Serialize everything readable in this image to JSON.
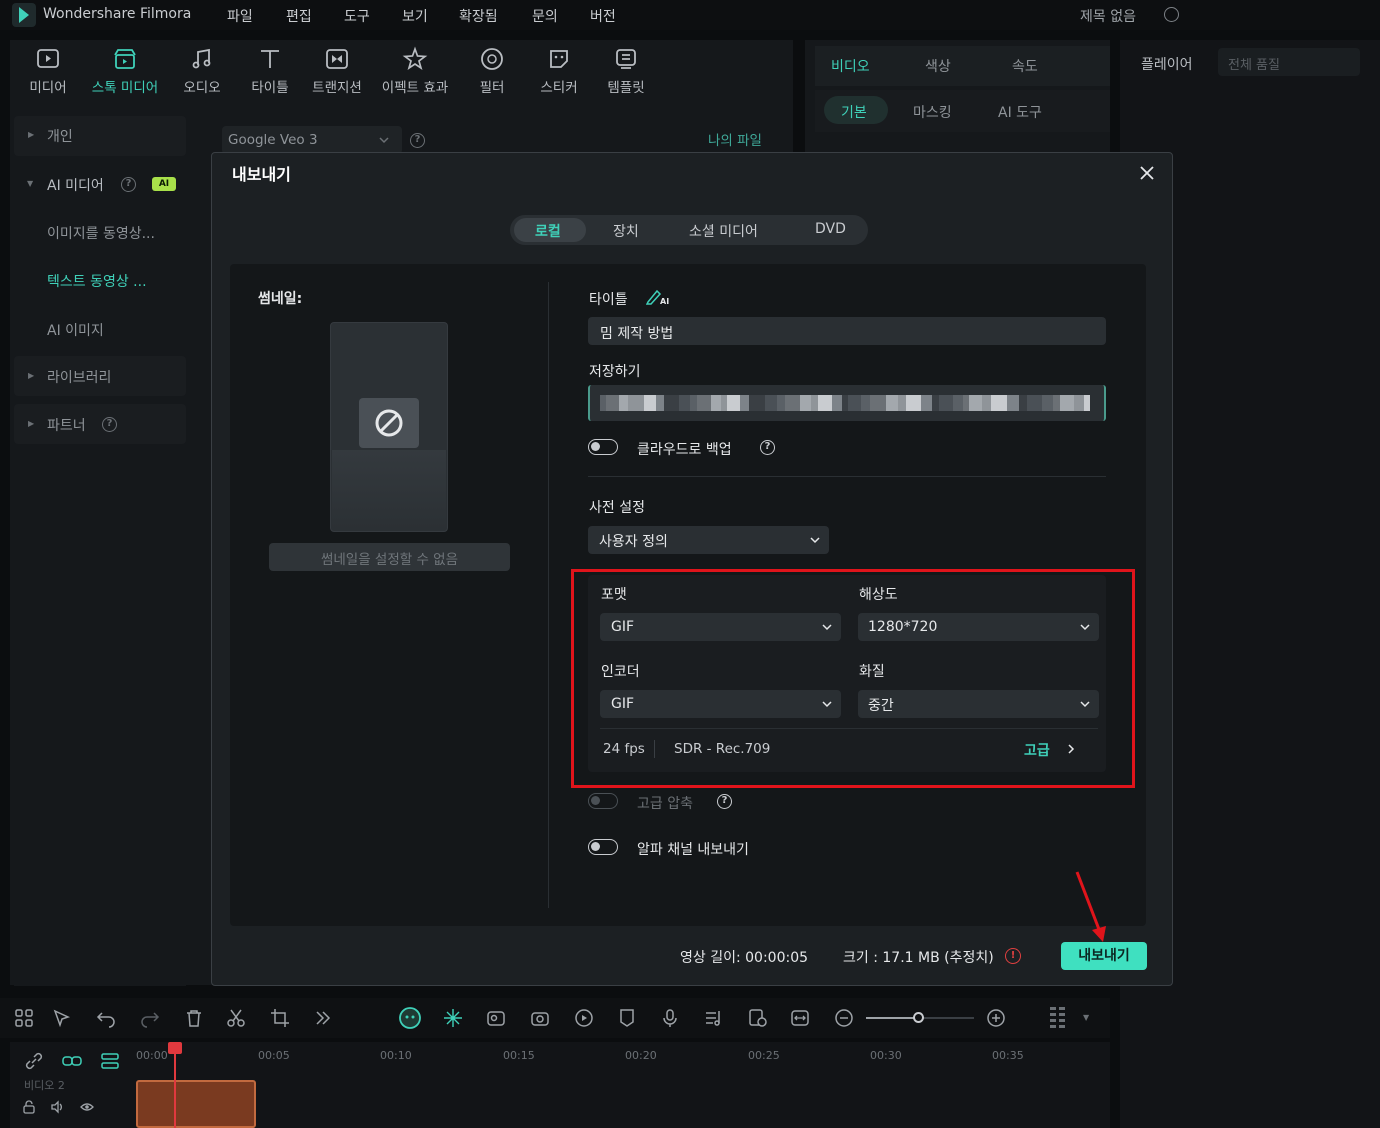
{
  "app": {
    "name": "Wondershare Filmora",
    "menu": [
      "파일",
      "편집",
      "도구",
      "보기",
      "확장됨",
      "문의",
      "버전"
    ],
    "doc_title": "제목 없음"
  },
  "toolbar": {
    "items": [
      {
        "label": "미디어",
        "icon": "media-icon"
      },
      {
        "label": "스톡 미디어",
        "icon": "stock-media-icon",
        "active": true
      },
      {
        "label": "오디오",
        "icon": "audio-icon"
      },
      {
        "label": "타이틀",
        "icon": "title-icon"
      },
      {
        "label": "트랜지션",
        "icon": "transition-icon"
      },
      {
        "label": "이펙트 효과",
        "icon": "effects-icon"
      },
      {
        "label": "필터",
        "icon": "filter-icon"
      },
      {
        "label": "스티커",
        "icon": "sticker-icon"
      },
      {
        "label": "템플릿",
        "icon": "template-icon"
      }
    ]
  },
  "library": {
    "items": [
      {
        "label": "개인"
      },
      {
        "label": "AI 미디어",
        "badge": "AI"
      },
      {
        "label": "이미지를 동영상..."
      },
      {
        "label": "텍스트 동영상 ..."
      },
      {
        "label": "AI 이미지"
      },
      {
        "label": "라이브러리"
      },
      {
        "label": "파트너"
      }
    ],
    "model_select": "Google Veo 3",
    "my_files": "나의 파일"
  },
  "right_panel": {
    "tabs": [
      "비디오",
      "색상",
      "속도"
    ],
    "sub_tabs": [
      "기본",
      "마스킹",
      "AI 도구"
    ]
  },
  "player": {
    "label": "플레이어",
    "quality": "전체 품질"
  },
  "timeline": {
    "timecodes": [
      "00:00",
      "00:05",
      "00:10",
      "00:15",
      "00:20",
      "00:25",
      "00:30",
      "00:35"
    ],
    "track": "비디오 2"
  },
  "dialog": {
    "title": "내보내기",
    "tabs": [
      "로컬",
      "장치",
      "소셜 미디어",
      "DVD"
    ],
    "thumbnail_label": "썸네일:",
    "thumbnail_button": "썸네일을 설정할 수 없음",
    "title_label": "타이틀",
    "title_value": "밈 제작 방법",
    "save_label": "저장하기",
    "cloud_backup": "클라우드로 백업",
    "preset_label": "사전 설정",
    "preset_value": "사용자 정의",
    "format_label": "포맷",
    "format_value": "GIF",
    "resolution_label": "해상도",
    "resolution_value": "1280*720",
    "encoder_label": "인코더",
    "encoder_value": "GIF",
    "quality_label": "화질",
    "quality_value": "중간",
    "fps": "24 fps",
    "color_space": "SDR - Rec.709",
    "advanced": "고급",
    "advanced_compress": "고급 압축",
    "alpha_export": "알파 채널 내보내기",
    "length_label": "영상 길이:",
    "length_value": "00:00:05",
    "size_label": "크기 :",
    "size_value": "17.1 MB (추정치)",
    "export_button": "내보내기"
  },
  "colors": {
    "accent": "#3fd1b9",
    "export_button": "#3fe0c0",
    "highlight": "#e0141b"
  }
}
